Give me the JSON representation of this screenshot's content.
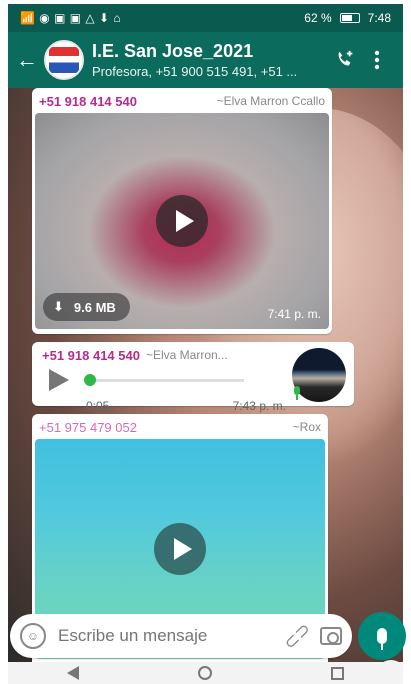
{
  "status_bar": {
    "icons": "📶 ◉ ▣ ▣ △ ⬇ ⌂",
    "battery": "62 %",
    "time": "7:48"
  },
  "header": {
    "title": "I.E. San Jose_2021",
    "subtitle": "Profesora, +51 900 515 491, +51 ..."
  },
  "messages": [
    {
      "sender_phone": "+51 918 414 540",
      "sender_alias": "~Elva Marron Ccallo",
      "type": "video",
      "size": "9.6 MB",
      "time": "7:41 p. m."
    },
    {
      "sender_phone": "+51 918 414 540",
      "sender_alias": "~Elva Marron...",
      "type": "audio",
      "duration": "0:05",
      "time": "7:43 p. m.",
      "progress": 0
    },
    {
      "sender_phone": "+51 975 479 052",
      "sender_alias": "~Rox",
      "type": "video"
    }
  ],
  "composer": {
    "placeholder": "Escribe un mensaje"
  },
  "colors": {
    "header": "#0b6b5c",
    "accent": "#00897b",
    "sender": "#b52d8c"
  },
  "icons": [
    "back-arrow-icon",
    "add-call-icon",
    "menu-dots-icon",
    "play-icon",
    "download-icon",
    "mic-icon",
    "emoji-icon",
    "attach-icon",
    "camera-icon",
    "scroll-down-icon"
  ]
}
